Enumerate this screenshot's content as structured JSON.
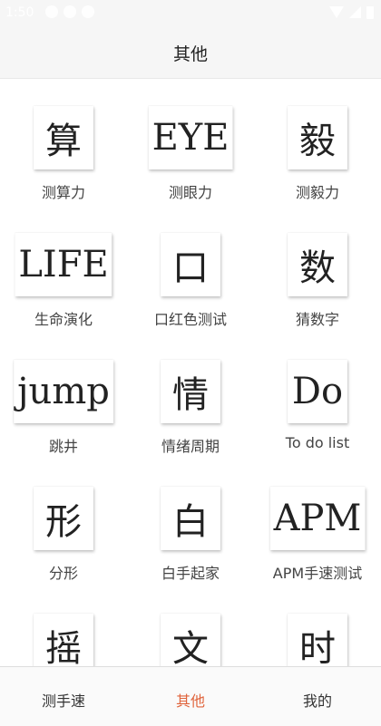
{
  "status_bar": {
    "time": "1:50"
  },
  "header": {
    "title": "其他"
  },
  "grid": {
    "items": [
      {
        "tile": "算",
        "label": "测算力"
      },
      {
        "tile": "EYE",
        "label": "测眼力"
      },
      {
        "tile": "毅",
        "label": "测毅力"
      },
      {
        "tile": "LIFE",
        "label": "生命演化"
      },
      {
        "tile": "口",
        "label": "口红色测试"
      },
      {
        "tile": "数",
        "label": "猜数字"
      },
      {
        "tile": "jump",
        "label": "跳井"
      },
      {
        "tile": "情",
        "label": "情绪周期"
      },
      {
        "tile": "Do",
        "label": "To do list"
      },
      {
        "tile": "形",
        "label": "分形"
      },
      {
        "tile": "白",
        "label": "白手起家"
      },
      {
        "tile": "APM",
        "label": "APM手速测试"
      },
      {
        "tile": "摇",
        "label": ""
      },
      {
        "tile": "文",
        "label": ""
      },
      {
        "tile": "时",
        "label": ""
      }
    ]
  },
  "tabs": [
    {
      "label": "测手速",
      "active": false
    },
    {
      "label": "其他",
      "active": true
    },
    {
      "label": "我的",
      "active": false
    }
  ],
  "colors": {
    "accent": "#e0643c",
    "header_bg": "#f6f6f6"
  }
}
